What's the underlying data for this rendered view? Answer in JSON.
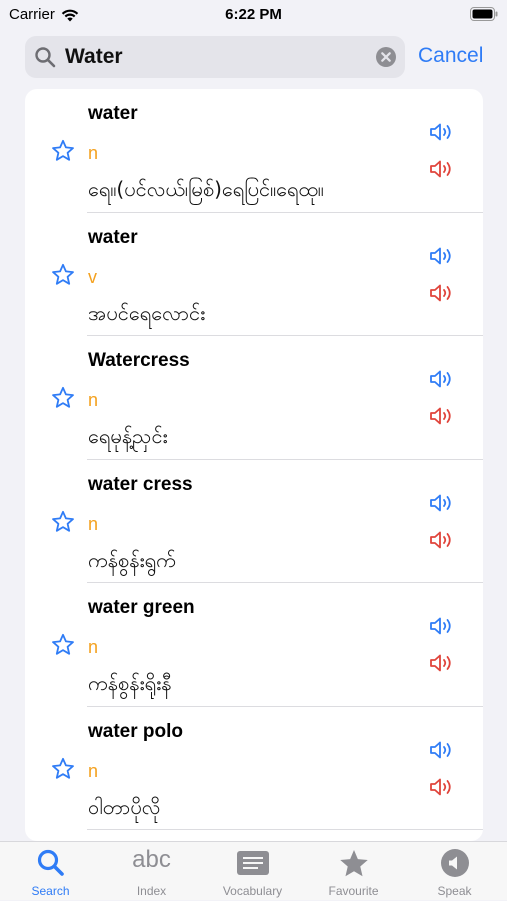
{
  "status_bar": {
    "carrier": "Carrier",
    "time": "6:22 PM"
  },
  "search": {
    "value": "Water",
    "cancel_label": "Cancel"
  },
  "colors": {
    "accent": "#2f7cf6",
    "pos": "#f4a11f",
    "speaker_blue": "#2f7cf6",
    "speaker_red": "#e0443b"
  },
  "results": [
    {
      "word": "water",
      "pos": "n",
      "meaning": "ရေ။(ပင်လယ်၊မြစ်)ရေပြင်။ရေထု။"
    },
    {
      "word": "water",
      "pos": "v",
      "meaning": "အပင်ရေလောင်း"
    },
    {
      "word": "Watercress",
      "pos": "n",
      "meaning": "ရေမုန့်ညှင်း"
    },
    {
      "word": "water cress",
      "pos": "n",
      "meaning": "ကန်စွန်းရွက်"
    },
    {
      "word": "water green",
      "pos": "n",
      "meaning": "ကန်စွန်းရိုးနီ"
    },
    {
      "word": "water polo",
      "pos": "n",
      "meaning": "ဝါတာပိုလို"
    }
  ],
  "tabs": [
    {
      "label": "Search",
      "icon": "search-icon",
      "active": true
    },
    {
      "label": "Index",
      "icon": "abc-icon",
      "glyph": "abc",
      "active": false
    },
    {
      "label": "Vocabulary",
      "icon": "list-icon",
      "active": false
    },
    {
      "label": "Favourite",
      "icon": "star-filled-icon",
      "active": false
    },
    {
      "label": "Speak",
      "icon": "speaker-circle-icon",
      "active": false
    }
  ]
}
